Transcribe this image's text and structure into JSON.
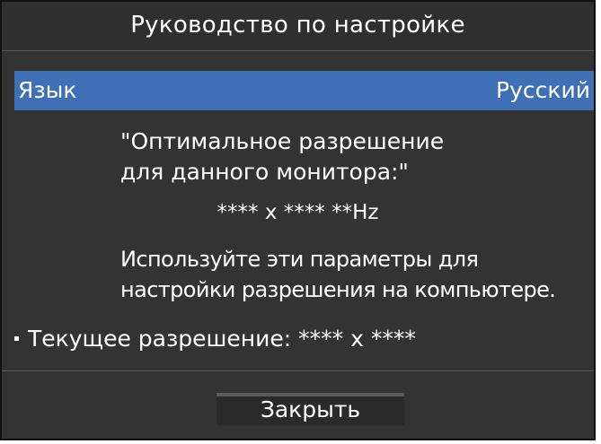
{
  "dialog": {
    "title": "Руководство по настройке"
  },
  "language": {
    "label": "Язык",
    "value": "Русский"
  },
  "info": {
    "heading": "\"Оптимальное разрешение\nдля данного монитора:\"",
    "resolution": "**** x **** **Hz",
    "advice": "Используйте эти параметры для\nнастройки разрешения на компьютере."
  },
  "current": {
    "text": "Текущее разрешение: **** x ****"
  },
  "buttons": {
    "close_label": "Закрыть"
  },
  "colors": {
    "dialog_background": "#333333",
    "selected_row": "#3f6fb4",
    "text": "#ffffff"
  }
}
